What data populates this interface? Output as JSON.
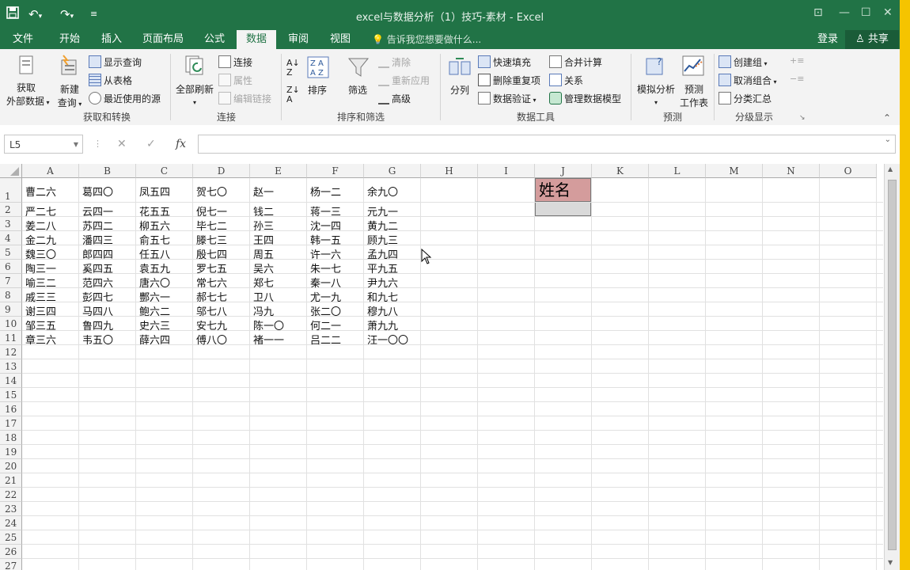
{
  "app": {
    "title": "excel与数据分析（1）技巧-素材 - Excel",
    "quick_access": {
      "save_icon": "save-icon",
      "undo_icon": "undo-icon",
      "redo_icon": "redo-icon",
      "customize_icon": "customize-icon"
    }
  },
  "tabs": {
    "items": [
      "文件",
      "开始",
      "插入",
      "页面布局",
      "公式",
      "数据",
      "审阅",
      "视图"
    ],
    "active": "数据",
    "tell_me": "告诉我您想要做什么...",
    "login": "登录",
    "share": "共享"
  },
  "ribbon": {
    "get_external": [
      "获取",
      "外部数据"
    ],
    "new_query": [
      "新建",
      "查询"
    ],
    "show_queries": "显示查询",
    "from_table": "从表格",
    "recent_sources": "最近使用的源",
    "group_get_transform": "获取和转换",
    "refresh_all": "全部刷新",
    "connections": "连接",
    "properties": "属性",
    "edit_links": "编辑链接",
    "group_connections": "连接",
    "sort": "排序",
    "filter": "筛选",
    "clear": "清除",
    "reapply": "重新应用",
    "advanced": "高级",
    "group_sort_filter": "排序和筛选",
    "text_to_columns": "分列",
    "flash_fill": "快速填充",
    "remove_duplicates": "删除重复项",
    "data_validation": "数据验证",
    "consolidate": "合并计算",
    "relationships": "关系",
    "manage_data_model": "管理数据模型",
    "group_data_tools": "数据工具",
    "what_if": "模拟分析",
    "forecast": [
      "预测",
      "工作表"
    ],
    "group_forecast": "预测",
    "group_btn": "创建组",
    "ungroup": "取消组合",
    "subtotal": "分类汇总",
    "group_outline": "分级显示"
  },
  "formula_bar": {
    "name_box": "L5",
    "formula": "",
    "fx_label": "fx"
  },
  "sheet": {
    "columns": [
      "A",
      "B",
      "C",
      "D",
      "E",
      "F",
      "G",
      "H",
      "I",
      "J",
      "K",
      "L",
      "M",
      "N",
      "O"
    ],
    "rows": [
      "1",
      "2",
      "3",
      "4",
      "5",
      "6",
      "7",
      "8",
      "9",
      "10",
      "11",
      "12",
      "13",
      "14",
      "15",
      "16",
      "17",
      "18",
      "19",
      "20",
      "21",
      "22",
      "23",
      "24",
      "25",
      "26",
      "27"
    ],
    "data": [
      [
        "曹二六",
        "葛四〇",
        "凤五四",
        "贺七〇",
        "赵一",
        "杨一二",
        "余九〇"
      ],
      [
        "严二七",
        "云四一",
        "花五五",
        "倪七一",
        "钱二",
        "蒋一三",
        "元九一"
      ],
      [
        "姜二八",
        "苏四二",
        "柳五六",
        "毕七二",
        "孙三",
        "沈一四",
        "黄九二"
      ],
      [
        "金二九",
        "潘四三",
        "俞五七",
        "滕七三",
        "王四",
        "韩一五",
        "顾九三"
      ],
      [
        "魏三〇",
        "郎四四",
        "任五八",
        "殷七四",
        "周五",
        "许一六",
        "孟九四"
      ],
      [
        "陶三一",
        "奚四五",
        "袁五九",
        "罗七五",
        "吴六",
        "朱一七",
        "平九五"
      ],
      [
        "喻三二",
        "范四六",
        "唐六〇",
        "常七六",
        "郑七",
        "秦一八",
        "尹九六"
      ],
      [
        "戚三三",
        "彭四七",
        "酆六一",
        "郝七七",
        "卫八",
        "尤一九",
        "和九七"
      ],
      [
        "谢三四",
        "马四八",
        "鲍六二",
        "邬七八",
        "冯九",
        "张二〇",
        "穆九八"
      ],
      [
        "邹三五",
        "鲁四九",
        "史六三",
        "安七九",
        "陈一〇",
        "何二一",
        "萧九九"
      ],
      [
        "章三六",
        "韦五〇",
        "薛六四",
        "傅八〇",
        "褚一一",
        "吕二二",
        "汪一〇〇"
      ]
    ],
    "j1_header": "姓名",
    "colors": {
      "header_fill": "#d49c9c",
      "j2_fill": "#d9d9d9",
      "title_green": "#217346"
    }
  }
}
